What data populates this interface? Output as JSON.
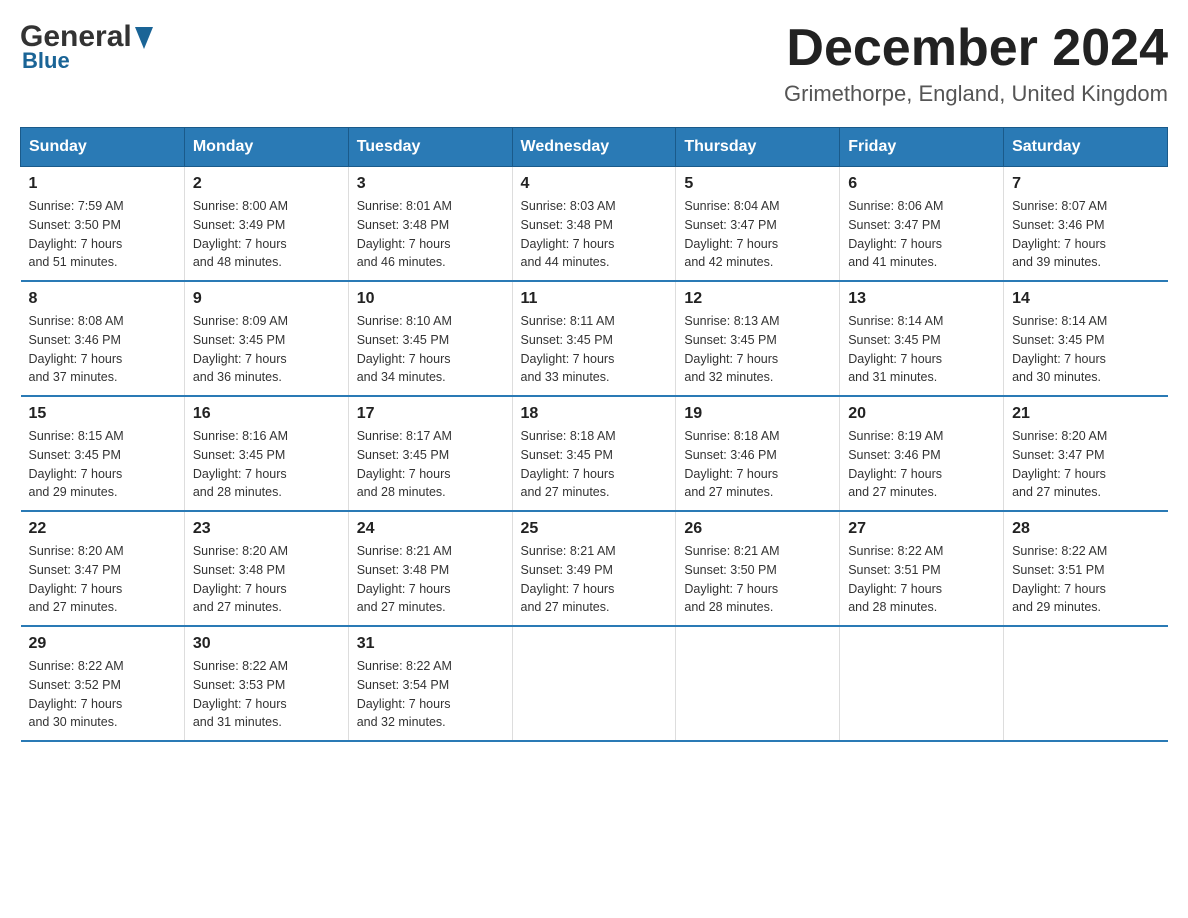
{
  "header": {
    "logo_general": "General",
    "logo_blue": "Blue",
    "month_title": "December 2024",
    "location": "Grimethorpe, England, United Kingdom"
  },
  "days_of_week": [
    "Sunday",
    "Monday",
    "Tuesday",
    "Wednesday",
    "Thursday",
    "Friday",
    "Saturday"
  ],
  "weeks": [
    [
      {
        "day": "1",
        "sunrise": "7:59 AM",
        "sunset": "3:50 PM",
        "daylight": "7 hours and 51 minutes."
      },
      {
        "day": "2",
        "sunrise": "8:00 AM",
        "sunset": "3:49 PM",
        "daylight": "7 hours and 48 minutes."
      },
      {
        "day": "3",
        "sunrise": "8:01 AM",
        "sunset": "3:48 PM",
        "daylight": "7 hours and 46 minutes."
      },
      {
        "day": "4",
        "sunrise": "8:03 AM",
        "sunset": "3:48 PM",
        "daylight": "7 hours and 44 minutes."
      },
      {
        "day": "5",
        "sunrise": "8:04 AM",
        "sunset": "3:47 PM",
        "daylight": "7 hours and 42 minutes."
      },
      {
        "day": "6",
        "sunrise": "8:06 AM",
        "sunset": "3:47 PM",
        "daylight": "7 hours and 41 minutes."
      },
      {
        "day": "7",
        "sunrise": "8:07 AM",
        "sunset": "3:46 PM",
        "daylight": "7 hours and 39 minutes."
      }
    ],
    [
      {
        "day": "8",
        "sunrise": "8:08 AM",
        "sunset": "3:46 PM",
        "daylight": "7 hours and 37 minutes."
      },
      {
        "day": "9",
        "sunrise": "8:09 AM",
        "sunset": "3:45 PM",
        "daylight": "7 hours and 36 minutes."
      },
      {
        "day": "10",
        "sunrise": "8:10 AM",
        "sunset": "3:45 PM",
        "daylight": "7 hours and 34 minutes."
      },
      {
        "day": "11",
        "sunrise": "8:11 AM",
        "sunset": "3:45 PM",
        "daylight": "7 hours and 33 minutes."
      },
      {
        "day": "12",
        "sunrise": "8:13 AM",
        "sunset": "3:45 PM",
        "daylight": "7 hours and 32 minutes."
      },
      {
        "day": "13",
        "sunrise": "8:14 AM",
        "sunset": "3:45 PM",
        "daylight": "7 hours and 31 minutes."
      },
      {
        "day": "14",
        "sunrise": "8:14 AM",
        "sunset": "3:45 PM",
        "daylight": "7 hours and 30 minutes."
      }
    ],
    [
      {
        "day": "15",
        "sunrise": "8:15 AM",
        "sunset": "3:45 PM",
        "daylight": "7 hours and 29 minutes."
      },
      {
        "day": "16",
        "sunrise": "8:16 AM",
        "sunset": "3:45 PM",
        "daylight": "7 hours and 28 minutes."
      },
      {
        "day": "17",
        "sunrise": "8:17 AM",
        "sunset": "3:45 PM",
        "daylight": "7 hours and 28 minutes."
      },
      {
        "day": "18",
        "sunrise": "8:18 AM",
        "sunset": "3:45 PM",
        "daylight": "7 hours and 27 minutes."
      },
      {
        "day": "19",
        "sunrise": "8:18 AM",
        "sunset": "3:46 PM",
        "daylight": "7 hours and 27 minutes."
      },
      {
        "day": "20",
        "sunrise": "8:19 AM",
        "sunset": "3:46 PM",
        "daylight": "7 hours and 27 minutes."
      },
      {
        "day": "21",
        "sunrise": "8:20 AM",
        "sunset": "3:47 PM",
        "daylight": "7 hours and 27 minutes."
      }
    ],
    [
      {
        "day": "22",
        "sunrise": "8:20 AM",
        "sunset": "3:47 PM",
        "daylight": "7 hours and 27 minutes."
      },
      {
        "day": "23",
        "sunrise": "8:20 AM",
        "sunset": "3:48 PM",
        "daylight": "7 hours and 27 minutes."
      },
      {
        "day": "24",
        "sunrise": "8:21 AM",
        "sunset": "3:48 PM",
        "daylight": "7 hours and 27 minutes."
      },
      {
        "day": "25",
        "sunrise": "8:21 AM",
        "sunset": "3:49 PM",
        "daylight": "7 hours and 27 minutes."
      },
      {
        "day": "26",
        "sunrise": "8:21 AM",
        "sunset": "3:50 PM",
        "daylight": "7 hours and 28 minutes."
      },
      {
        "day": "27",
        "sunrise": "8:22 AM",
        "sunset": "3:51 PM",
        "daylight": "7 hours and 28 minutes."
      },
      {
        "day": "28",
        "sunrise": "8:22 AM",
        "sunset": "3:51 PM",
        "daylight": "7 hours and 29 minutes."
      }
    ],
    [
      {
        "day": "29",
        "sunrise": "8:22 AM",
        "sunset": "3:52 PM",
        "daylight": "7 hours and 30 minutes."
      },
      {
        "day": "30",
        "sunrise": "8:22 AM",
        "sunset": "3:53 PM",
        "daylight": "7 hours and 31 minutes."
      },
      {
        "day": "31",
        "sunrise": "8:22 AM",
        "sunset": "3:54 PM",
        "daylight": "7 hours and 32 minutes."
      },
      null,
      null,
      null,
      null
    ]
  ],
  "labels": {
    "sunrise": "Sunrise:",
    "sunset": "Sunset:",
    "daylight": "Daylight:"
  }
}
